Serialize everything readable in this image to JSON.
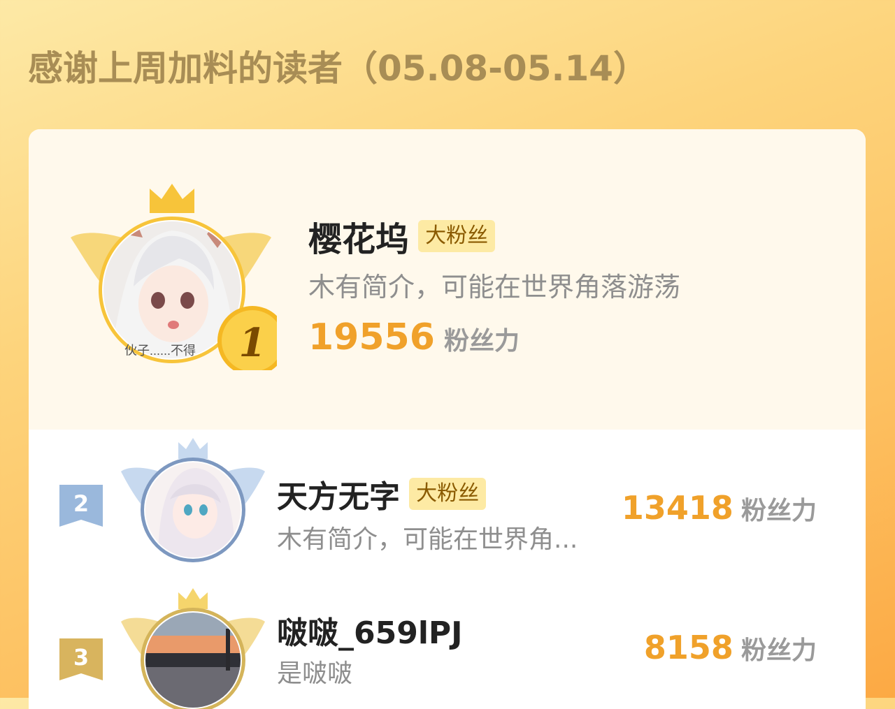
{
  "page": {
    "title": "感谢上周加料的读者（05.08-05.14）"
  },
  "colors": {
    "accent_score": "#f0a12a",
    "badge_bg": "#fdeaa4",
    "gold": "#f7c43a",
    "silver_blue": "#9ab8dc",
    "bronze": "#d8b45e"
  },
  "leaders": [
    {
      "rank": "1",
      "name": "樱花坞",
      "badge": "大粉丝",
      "bio": "木有简介，可能在世界角落游荡",
      "score": "19556",
      "unit": "粉丝力",
      "avatar_caption": "伙子......不得",
      "crown": "gold-crown-icon"
    },
    {
      "rank": "2",
      "name": "天方无字",
      "badge": "大粉丝",
      "bio": "木有简介，可能在世界角...",
      "score": "13418",
      "unit": "粉丝力",
      "crown": "silver-crown-icon"
    },
    {
      "rank": "3",
      "name": "啵啵_659lPJ",
      "bio": "是啵啵",
      "score": "8158",
      "unit": "粉丝力",
      "crown": "bronze-crown-icon"
    }
  ]
}
